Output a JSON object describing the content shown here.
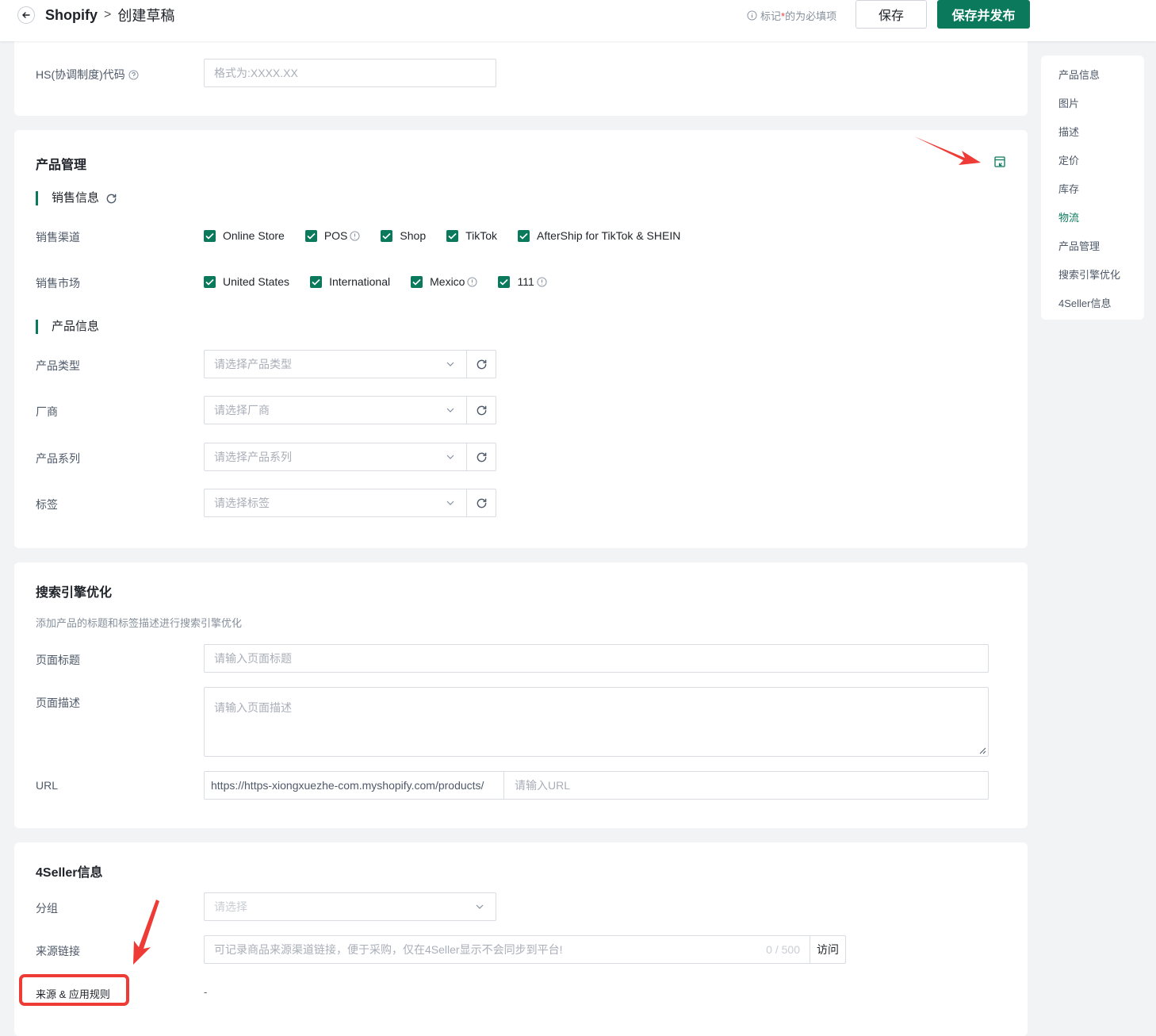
{
  "header": {
    "app": "Shopify",
    "separator": ">",
    "page_title": "创建草稿",
    "required_prefix": "标记",
    "required_star": "*",
    "required_suffix": "的为必填项",
    "save_label": "保存",
    "publish_label": "保存并发布"
  },
  "top_card": {
    "hs_label": "HS(协调制度)代码",
    "hs_placeholder": "格式为:XXXX.XX"
  },
  "product_management": {
    "title": "产品管理",
    "sales_info_title": "销售信息",
    "channels_label": "销售渠道",
    "channels": [
      "Online Store",
      "POS",
      "Shop",
      "TikTok",
      "AfterShip for TikTok & SHEIN"
    ],
    "markets_label": "销售市场",
    "markets": [
      "United States",
      "International",
      "Mexico",
      "111"
    ],
    "product_info_title": "产品信息",
    "fields": [
      {
        "label": "产品类型",
        "placeholder": "请选择产品类型"
      },
      {
        "label": "厂商",
        "placeholder": "请选择厂商"
      },
      {
        "label": "产品系列",
        "placeholder": "请选择产品系列"
      },
      {
        "label": "标签",
        "placeholder": "请选择标签"
      }
    ]
  },
  "seo": {
    "title": "搜索引擎优化",
    "description": "添加产品的标题和标签描述进行搜索引擎优化",
    "page_title_label": "页面标题",
    "page_title_placeholder": "请输入页面标题",
    "page_desc_label": "页面描述",
    "page_desc_placeholder": "请输入页面描述",
    "url_label": "URL",
    "url_prefix": "https://https-xiongxuezhe-com.myshopify.com/products/",
    "url_placeholder": "请输入URL"
  },
  "seller": {
    "title": "4Seller信息",
    "group_label": "分组",
    "group_placeholder": "请选择",
    "source_label": "来源链接",
    "source_placeholder": "可记录商品来源渠道链接，便于采购，仅在4Seller显示不会同步到平台!",
    "source_counter": "0 / 500",
    "visit_label": "访问",
    "rules_label": "来源 & 应用规则",
    "rules_value": "-"
  },
  "sidenav": {
    "items": [
      "产品信息",
      "图片",
      "描述",
      "定价",
      "库存",
      "物流",
      "产品管理",
      "搜索引擎优化",
      "4Seller信息"
    ],
    "active": "物流"
  },
  "colors": {
    "accent": "#0b7a5c",
    "annotation": "#ef3b36"
  }
}
